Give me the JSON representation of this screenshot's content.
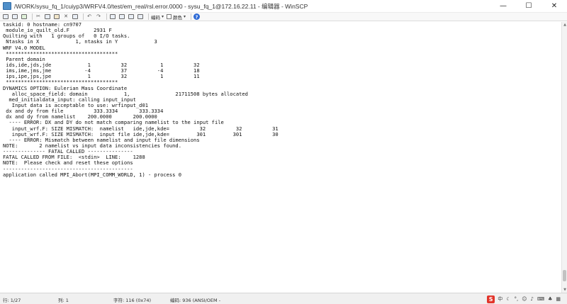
{
  "window": {
    "title": "/WORK/sysu_fq_1/cuiyp3/WRFV4.0/test/em_real/rsl.error.0000 - sysu_fq_1@172.16.22.11 - 编辑器 - WinSCP",
    "minimize_glyph": "—",
    "maximize_glyph": "☐",
    "close_glyph": "✕"
  },
  "toolbar": {
    "encoding_label": "编码",
    "color_label": "颜色",
    "dropdown_glyph": "▾",
    "help_glyph": "?"
  },
  "editor": {
    "lines": [
      "taskid: 0 hostname: cn9707",
      " module_io_quilt_old.F        2931 F",
      "Quilting with   1 groups of   0 I/O tasks.",
      " Ntasks in X            1, ntasks in Y            3",
      "WRF V4.0 MODEL",
      " *************************************",
      " Parent domain",
      " ids,ide,jds,jde            1          32           1          32",
      " ims,ime,jms,jme           -4          37          -4          18",
      " ips,ipe,jps,jpe            1          32           1          11",
      " *************************************",
      "DYNAMICS OPTION: Eulerian Mass Coordinate",
      "   alloc_space_field: domain            1,               21711508 bytes allocated",
      "  med_initialdata_input: calling input_input",
      "   Input data is acceptable to use: wrfinput_d01",
      " dx and dy from file          333.3334       333.3334",
      " dx and dy from namelist    200.0000       200.0000",
      "  ---- ERROR: DX and DY do not match comparing namelist to the input file",
      "   input_wrf.F: SIZE MISMATCH:  namelist   ide,jde,kde=          32          32          31",
      "   input_wrf.F: SIZE MISMATCH:  input file ide,jde,kde=         301         301          30",
      "  ---- ERROR: Mismatch between namelist and input file dimensions",
      "NOTE:       2 namelist vs input data inconsistencies found.",
      "-------------- FATAL CALLED ---------------",
      "FATAL CALLED FROM FILE:  <stdin>  LINE:    1288",
      "NOTE:  Please check and reset these options",
      "-------------------------------------------",
      "application called MPI_Abort(MPI_COMM_WORLD, 1) - process 0"
    ]
  },
  "statusbar": {
    "line": "行: 1/27",
    "column": "列: 1",
    "character": "字符: 116 (0x74)",
    "encoding": "编码: 936  (ANSI/OEM -"
  },
  "tray": {
    "ime_logo": "S",
    "ime_lang": "中"
  }
}
